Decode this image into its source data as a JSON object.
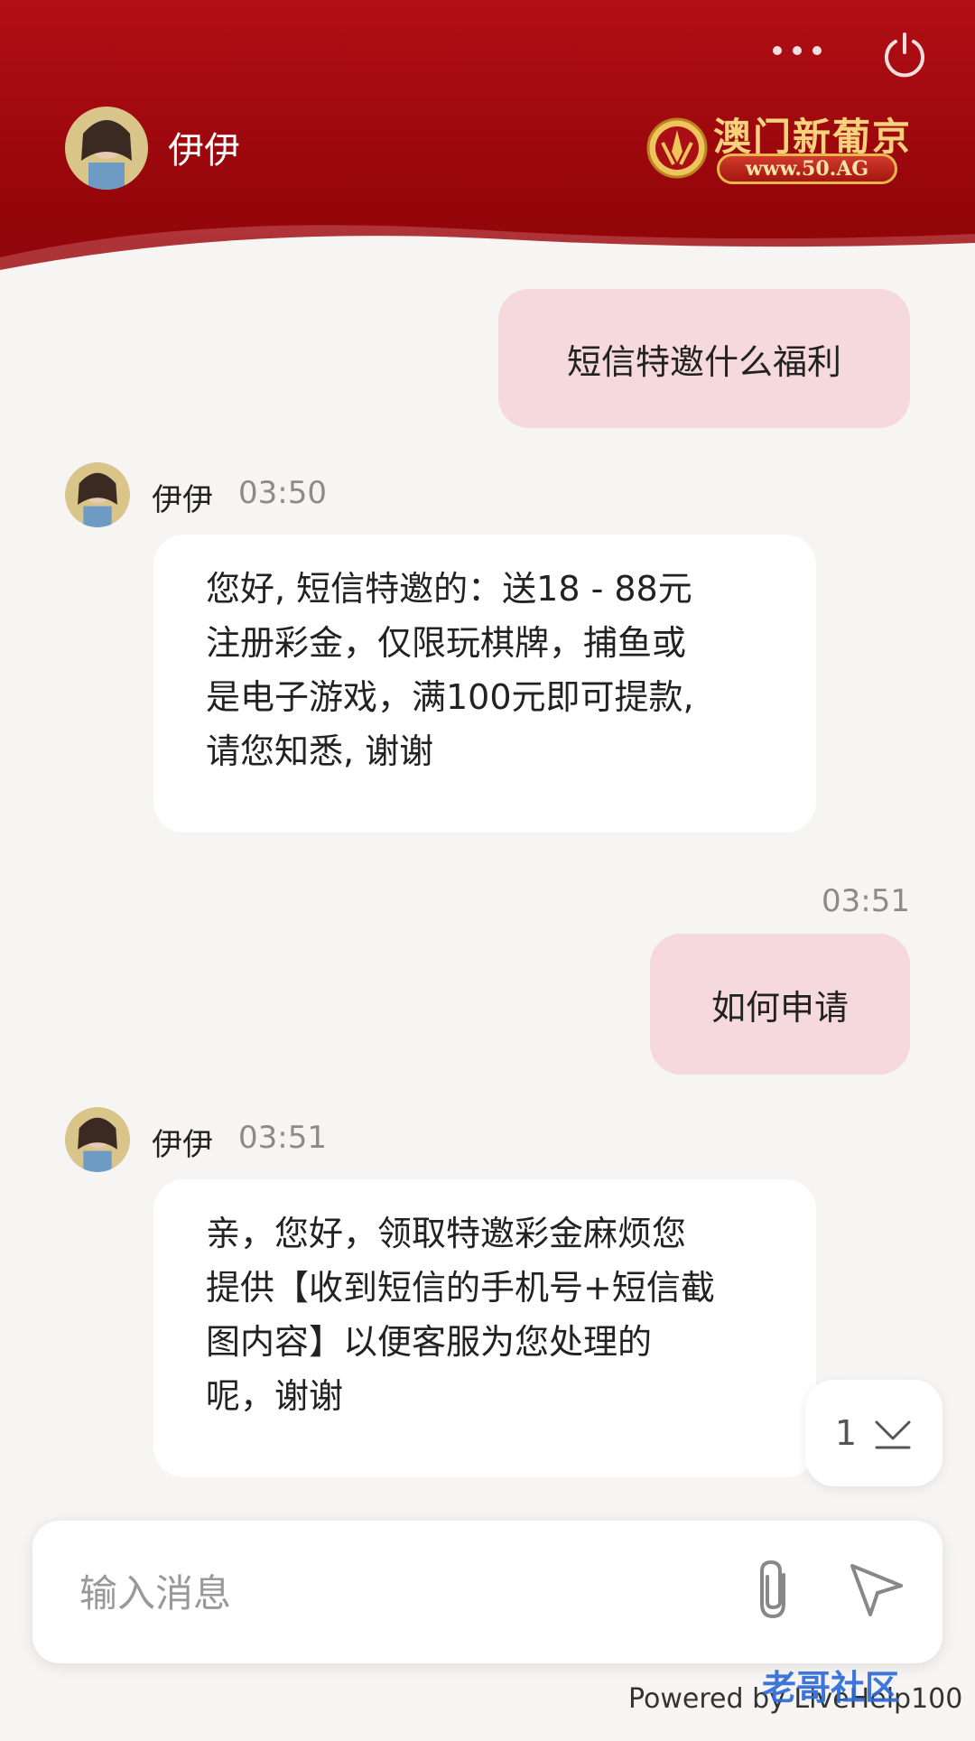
{
  "header": {
    "agent_name": "伊伊",
    "brand_name": "澳门新葡京",
    "brand_url": "www.50.AG"
  },
  "messages": [
    {
      "direction": "outgoing",
      "text": "短信特邀什么福利"
    },
    {
      "direction": "incoming",
      "sender": "伊伊",
      "time": "03:50",
      "lines": [
        "您好, 短信特邀的：送18 - 88元",
        "注册彩金，仅限玩棋牌，捕鱼或",
        "是电子游戏，满100元即可提款,",
        "请您知悉, 谢谢"
      ]
    },
    {
      "direction": "outgoing",
      "time": "03:51",
      "text": "如何申请"
    },
    {
      "direction": "incoming",
      "sender": "伊伊",
      "time": "03:51",
      "lines": [
        "亲，您好，领取特邀彩金麻烦您",
        "提供【收到短信的手机号+短信截",
        "图内容】以便客服为您处理的",
        "呢，谢谢"
      ]
    }
  ],
  "scroll_indicator": {
    "unread_count": "1"
  },
  "composer": {
    "placeholder": "输入消息"
  },
  "footer": {
    "powered_by": "Powered by LiveHelp100",
    "watermark": "老哥社区"
  },
  "colors": {
    "header_red": "#a00a10",
    "outgoing_bubble": "#f5d9dc",
    "incoming_bubble": "#ffffff",
    "background": "#f7f5f4"
  },
  "icons": [
    "more-icon",
    "power-icon",
    "attach-icon",
    "send-icon",
    "chevron-down-icon"
  ]
}
